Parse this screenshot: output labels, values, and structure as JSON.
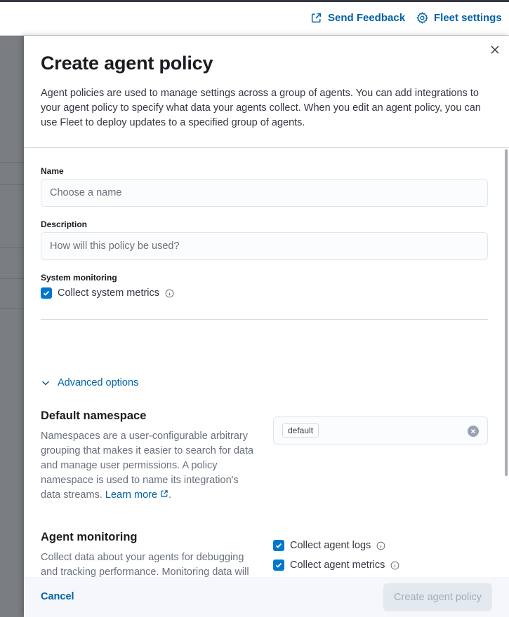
{
  "topbar": {
    "feedback_label": "Send Feedback",
    "settings_label": "Fleet settings"
  },
  "flyout": {
    "title": "Create agent policy",
    "description": "Agent policies are used to manage settings across a group of agents. You can add integrations to your agent policy to specify what data your agents collect. When you edit an agent policy, you can use Fleet to deploy updates to a specified group of agents."
  },
  "form": {
    "name_label": "Name",
    "name_placeholder": "Choose a name",
    "description_label": "Description",
    "description_placeholder": "How will this policy be used?",
    "system_monitoring_label": "System monitoring",
    "collect_system_metrics_label": "Collect system metrics",
    "advanced_options_label": "Advanced options"
  },
  "namespace": {
    "title": "Default namespace",
    "description": "Namespaces are a user-configurable arbitrary grouping that makes it easier to search for data and manage user permissions. A policy namespace is used to name its integration's data streams.",
    "learn_more": "Learn more",
    "period": ".",
    "value": "default"
  },
  "agent_monitoring": {
    "title": "Agent monitoring",
    "description": "Collect data about your agents for debugging and tracking performance. Monitoring data will be written to the default namespace specified above.",
    "logs_label": "Collect agent logs",
    "metrics_label": "Collect agent metrics"
  },
  "footer": {
    "cancel_label": "Cancel",
    "create_label": "Create agent policy"
  },
  "colors": {
    "accent": "#0077cc",
    "link": "#0061a6",
    "overlay": "#7a7d82"
  }
}
